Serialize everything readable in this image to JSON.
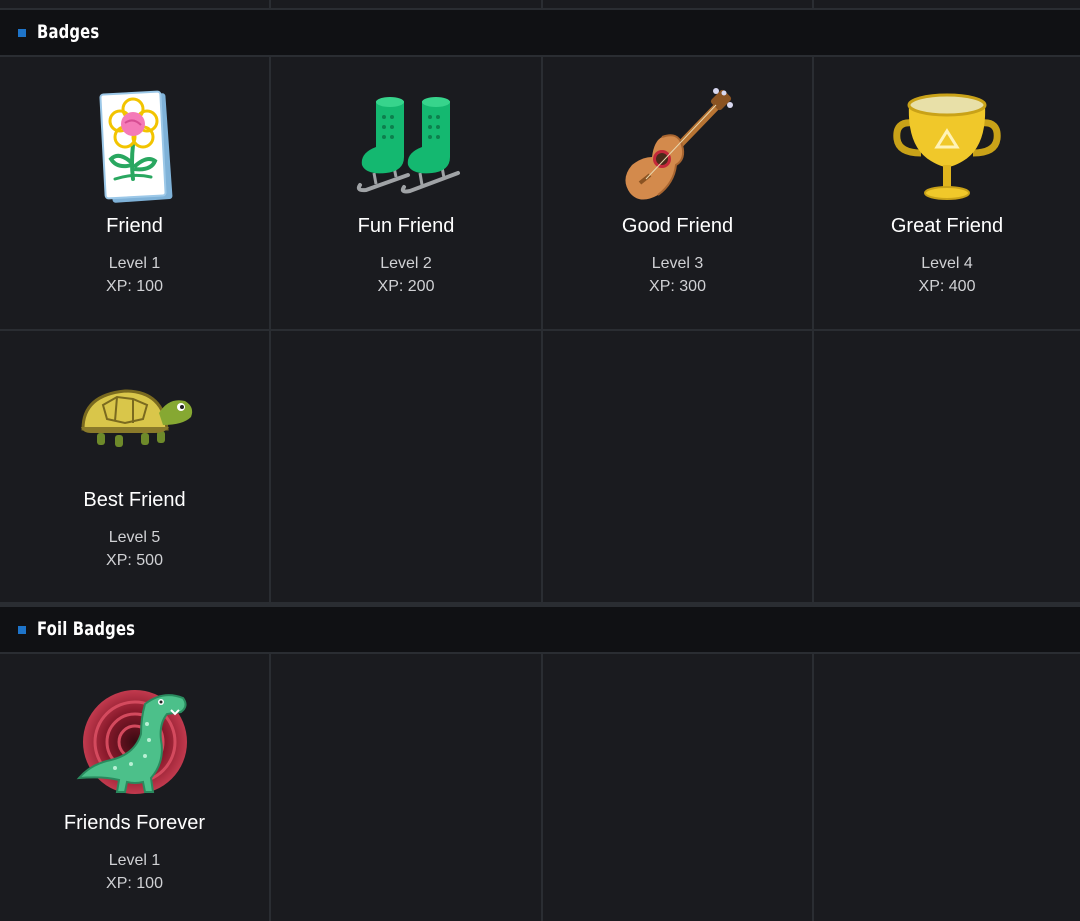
{
  "sections": [
    {
      "title": "Badges",
      "badges": [
        {
          "name": "Friend",
          "level": "Level 1",
          "xp": "XP: 100",
          "icon": "flower-card-icon"
        },
        {
          "name": "Fun Friend",
          "level": "Level 2",
          "xp": "XP: 200",
          "icon": "ice-skates-icon"
        },
        {
          "name": "Good Friend",
          "level": "Level 3",
          "xp": "XP: 300",
          "icon": "guitar-icon"
        },
        {
          "name": "Great Friend",
          "level": "Level 4",
          "xp": "XP: 400",
          "icon": "trophy-icon"
        },
        {
          "name": "Best Friend",
          "level": "Level 5",
          "xp": "XP: 500",
          "icon": "turtle-icon"
        }
      ]
    },
    {
      "title": "Foil Badges",
      "badges": [
        {
          "name": "Friends Forever",
          "level": "Level 1",
          "xp": "XP: 100",
          "icon": "dinosaur-icon"
        }
      ]
    }
  ],
  "colors": {
    "page_background": "#2a2d32",
    "cell_background": "#1a1b1f",
    "header_background": "#101114",
    "accent": "#1e74c9"
  }
}
